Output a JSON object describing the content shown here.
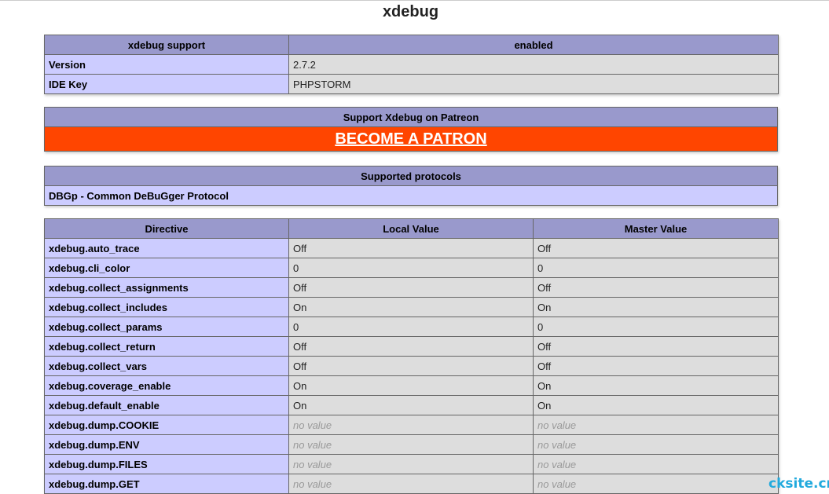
{
  "title": "xdebug",
  "support_table": {
    "header": [
      "xdebug support",
      "enabled"
    ],
    "rows": [
      [
        "Version",
        "2.7.2"
      ],
      [
        "IDE Key",
        "PHPSTORM"
      ]
    ]
  },
  "patron": {
    "header": "Support Xdebug on Patreon",
    "link_label": "BECOME A PATRON",
    "background_color": "#ff4500"
  },
  "protocols": {
    "header": "Supported protocols",
    "items": [
      "DBGp - Common DeBuGger Protocol"
    ]
  },
  "directives": {
    "columns": [
      "Directive",
      "Local Value",
      "Master Value"
    ],
    "rows": [
      [
        "xdebug.auto_trace",
        "Off",
        "Off"
      ],
      [
        "xdebug.cli_color",
        "0",
        "0"
      ],
      [
        "xdebug.collect_assignments",
        "Off",
        "Off"
      ],
      [
        "xdebug.collect_includes",
        "On",
        "On"
      ],
      [
        "xdebug.collect_params",
        "0",
        "0"
      ],
      [
        "xdebug.collect_return",
        "Off",
        "Off"
      ],
      [
        "xdebug.collect_vars",
        "Off",
        "Off"
      ],
      [
        "xdebug.coverage_enable",
        "On",
        "On"
      ],
      [
        "xdebug.default_enable",
        "On",
        "On"
      ],
      [
        "xdebug.dump.COOKIE",
        "no value",
        "no value"
      ],
      [
        "xdebug.dump.ENV",
        "no value",
        "no value"
      ],
      [
        "xdebug.dump.FILES",
        "no value",
        "no value"
      ],
      [
        "xdebug.dump.GET",
        "no value",
        "no value"
      ]
    ]
  },
  "watermark": "cksite.cn",
  "colors": {
    "header_bg": "#9999cc",
    "key_bg": "#ccccff",
    "value_bg": "#dddddd",
    "watermark": "#22aadd"
  }
}
